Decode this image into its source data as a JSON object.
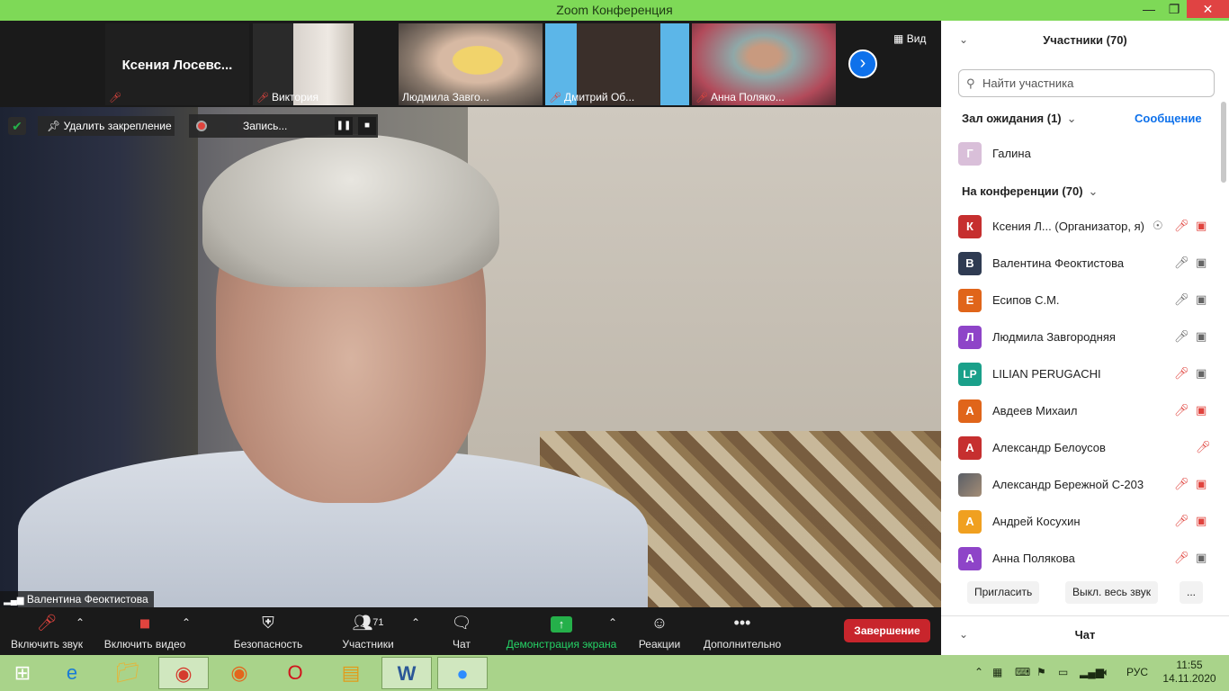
{
  "window": {
    "title": "Zoom Конференция"
  },
  "strip": {
    "thumbs": [
      {
        "name": "Ксения  Лосевс...",
        "muted": true,
        "style": "name-only"
      },
      {
        "name": "Виктория",
        "muted": true
      },
      {
        "name": "Людмила Завго...",
        "muted": false
      },
      {
        "name": "Дмитрий Об...",
        "muted": true
      },
      {
        "name": "Анна Поляко...",
        "muted": true
      }
    ],
    "view_label": "Вид"
  },
  "main": {
    "unpin_label": "Удалить закрепление",
    "recording_label": "Запись...",
    "speaker_name": "Валентина Феоктистова"
  },
  "toolbar": {
    "audio": "Включить звук",
    "video": "Включить видео",
    "security": "Безопасность",
    "participants": "Участники",
    "participants_count": "71",
    "chat": "Чат",
    "share": "Демонстрация экрана",
    "reactions": "Реакции",
    "more": "Дополнительно",
    "end": "Завершение"
  },
  "panel": {
    "title": "Участники (70)",
    "search_placeholder": "Найти участника",
    "waiting_title": "Зал ожидания (1)",
    "message_link": "Сообщение",
    "waiting": [
      {
        "initial": "Г",
        "name": "Галина",
        "color": "#d9bfd9"
      }
    ],
    "in_meeting_title": "На конференции (70)",
    "participants": [
      {
        "initial": "К",
        "name": "Ксения Л...  (Организатор, я)",
        "color": "#c62f2f",
        "audio": "muted",
        "video": "off",
        "host": true
      },
      {
        "initial": "В",
        "name": "Валентина Феоктистова",
        "color": "#2f3b52",
        "audio": "on",
        "video": "on"
      },
      {
        "initial": "Е",
        "name": "Есипов С.М.",
        "color": "#e0651a",
        "audio": "on",
        "video": "on"
      },
      {
        "initial": "Л",
        "name": "Людмила Завгородняя",
        "color": "#8e44c8",
        "audio": "on",
        "video": "on"
      },
      {
        "initial": "LP",
        "name": "LILIAN PERUGACHI",
        "color": "#1aa08a",
        "audio": "muted",
        "video": "on"
      },
      {
        "initial": "А",
        "name": "Авдеев Михаил",
        "color": "#e0651a",
        "audio": "muted",
        "video": "off"
      },
      {
        "initial": "А",
        "name": "Александр Белоусов",
        "color": "#c62f2f",
        "audio": "muted",
        "video": "none"
      },
      {
        "initial": "",
        "name": "Александр Бережной С-203",
        "color": "#5a5e66",
        "audio": "muted",
        "video": "off"
      },
      {
        "initial": "А",
        "name": "Андрей Косухин",
        "color": "#f0a020",
        "audio": "muted",
        "video": "off"
      },
      {
        "initial": "А",
        "name": "Анна Полякова",
        "color": "#8e44c8",
        "audio": "muted",
        "video": "on"
      }
    ],
    "invite": "Пригласить",
    "mute_all": "Выкл. весь звук",
    "more": "...",
    "chat_title": "Чат"
  },
  "taskbar": {
    "lang": "РУС",
    "time": "11:55",
    "date": "14.11.2020"
  }
}
